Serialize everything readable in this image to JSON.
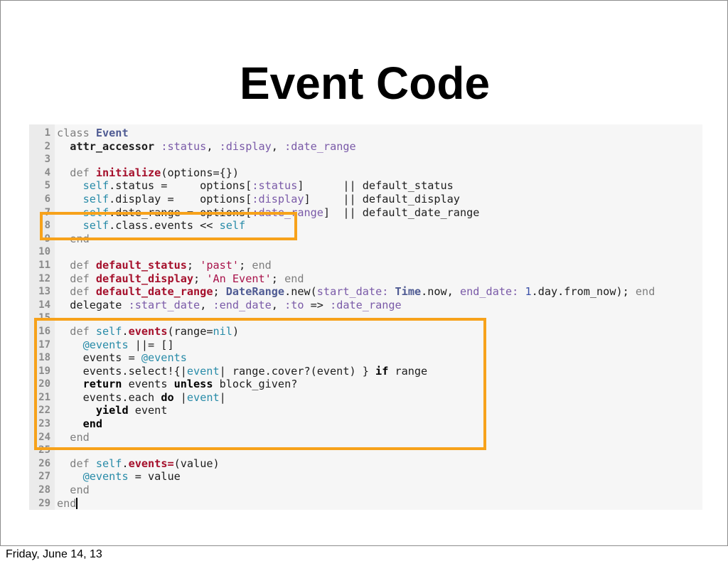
{
  "slide": {
    "title": "Event Code",
    "footer_date": "Friday, June 14, 13"
  },
  "colors": {
    "highlight_border": "#f7a21b",
    "code_background": "#f6f6f6",
    "gutter_background": "#ebebeb"
  },
  "code": {
    "language": "ruby",
    "lines": [
      {
        "n": "1",
        "tokens": [
          [
            "kw",
            "class "
          ],
          [
            "cls",
            "Event"
          ]
        ]
      },
      {
        "n": "2",
        "tokens": [
          [
            "plain",
            "  "
          ],
          [
            "bold",
            "attr_accessor"
          ],
          [
            "sym",
            " :status"
          ],
          [
            "plain",
            ", "
          ],
          [
            "sym",
            ":display"
          ],
          [
            "plain",
            ", "
          ],
          [
            "sym",
            ":date_range"
          ]
        ]
      },
      {
        "n": "3",
        "tokens": []
      },
      {
        "n": "4",
        "tokens": [
          [
            "plain",
            "  "
          ],
          [
            "kw",
            "def "
          ],
          [
            "def",
            "initialize"
          ],
          [
            "plain",
            "(options={})"
          ]
        ]
      },
      {
        "n": "5",
        "tokens": [
          [
            "plain",
            "    "
          ],
          [
            "self",
            "self"
          ],
          [
            "plain",
            ".status =     options["
          ],
          [
            "sym",
            ":status"
          ],
          [
            "plain",
            "]      || default_status"
          ]
        ]
      },
      {
        "n": "6",
        "tokens": [
          [
            "plain",
            "    "
          ],
          [
            "self",
            "self"
          ],
          [
            "plain",
            ".display =    options["
          ],
          [
            "sym",
            ":display"
          ],
          [
            "plain",
            "]     || default_display"
          ]
        ]
      },
      {
        "n": "7",
        "tokens": [
          [
            "plain",
            "    "
          ],
          [
            "self",
            "self"
          ],
          [
            "plain",
            ".date_range = options["
          ],
          [
            "sym",
            ":date_range"
          ],
          [
            "plain",
            "]  || default_date_range"
          ]
        ]
      },
      {
        "n": "8",
        "tokens": [
          [
            "plain",
            "    "
          ],
          [
            "self",
            "self"
          ],
          [
            "plain",
            ".class.events << "
          ],
          [
            "self",
            "self"
          ]
        ]
      },
      {
        "n": "9",
        "tokens": [
          [
            "plain",
            "  "
          ],
          [
            "kw",
            "end"
          ]
        ]
      },
      {
        "n": "10",
        "tokens": []
      },
      {
        "n": "11",
        "tokens": [
          [
            "plain",
            "  "
          ],
          [
            "kw",
            "def "
          ],
          [
            "def",
            "default_status"
          ],
          [
            "plain",
            "; "
          ],
          [
            "str",
            "'past'"
          ],
          [
            "plain",
            "; "
          ],
          [
            "kw",
            "end"
          ]
        ]
      },
      {
        "n": "12",
        "tokens": [
          [
            "plain",
            "  "
          ],
          [
            "kw",
            "def "
          ],
          [
            "def",
            "default_display"
          ],
          [
            "plain",
            "; "
          ],
          [
            "str",
            "'An Event'"
          ],
          [
            "plain",
            "; "
          ],
          [
            "kw",
            "end"
          ]
        ]
      },
      {
        "n": "13",
        "tokens": [
          [
            "plain",
            "  "
          ],
          [
            "kw",
            "def "
          ],
          [
            "def",
            "default_date_range"
          ],
          [
            "plain",
            "; "
          ],
          [
            "const",
            "DateRange"
          ],
          [
            "plain",
            ".new("
          ],
          [
            "sym",
            "start_date:"
          ],
          [
            "plain",
            " "
          ],
          [
            "const",
            "Time"
          ],
          [
            "plain",
            ".now, "
          ],
          [
            "sym",
            "end_date:"
          ],
          [
            "plain",
            " "
          ],
          [
            "num",
            "1"
          ],
          [
            "plain",
            ".day.from_now); "
          ],
          [
            "kw",
            "end"
          ]
        ]
      },
      {
        "n": "14",
        "tokens": [
          [
            "plain",
            "  delegate "
          ],
          [
            "sym",
            ":start_date"
          ],
          [
            "plain",
            ", "
          ],
          [
            "sym",
            ":end_date"
          ],
          [
            "plain",
            ", "
          ],
          [
            "sym",
            ":to"
          ],
          [
            "plain",
            " => "
          ],
          [
            "sym",
            ":date_range"
          ]
        ]
      },
      {
        "n": "15",
        "tokens": []
      },
      {
        "n": "16",
        "tokens": [
          [
            "plain",
            "  "
          ],
          [
            "kw",
            "def "
          ],
          [
            "self",
            "self"
          ],
          [
            "plain",
            "."
          ],
          [
            "def",
            "events"
          ],
          [
            "plain",
            "(range="
          ],
          [
            "self",
            "nil"
          ],
          [
            "plain",
            ")"
          ]
        ]
      },
      {
        "n": "17",
        "tokens": [
          [
            "plain",
            "    "
          ],
          [
            "ivar",
            "@events"
          ],
          [
            "plain",
            " ||= []"
          ]
        ]
      },
      {
        "n": "18",
        "tokens": [
          [
            "plain",
            "    events = "
          ],
          [
            "ivar",
            "@events"
          ]
        ]
      },
      {
        "n": "19",
        "tokens": [
          [
            "plain",
            "    events.select!{|"
          ],
          [
            "ivar",
            "event"
          ],
          [
            "plain",
            "| range.cover?(event) } "
          ],
          [
            "kwb",
            "if"
          ],
          [
            "plain",
            " range"
          ]
        ]
      },
      {
        "n": "20",
        "tokens": [
          [
            "plain",
            "    "
          ],
          [
            "kwb",
            "return"
          ],
          [
            "plain",
            " events "
          ],
          [
            "kwb",
            "unless"
          ],
          [
            "plain",
            " block_given?"
          ]
        ]
      },
      {
        "n": "21",
        "tokens": [
          [
            "plain",
            "    events.each "
          ],
          [
            "kwb",
            "do"
          ],
          [
            "plain",
            " |"
          ],
          [
            "ivar",
            "event"
          ],
          [
            "plain",
            "|"
          ]
        ]
      },
      {
        "n": "22",
        "tokens": [
          [
            "plain",
            "      "
          ],
          [
            "kwb",
            "yield"
          ],
          [
            "plain",
            " event"
          ]
        ]
      },
      {
        "n": "23",
        "tokens": [
          [
            "plain",
            "    "
          ],
          [
            "kwb",
            "end"
          ]
        ]
      },
      {
        "n": "24",
        "tokens": [
          [
            "plain",
            "  "
          ],
          [
            "kw",
            "end"
          ]
        ]
      },
      {
        "n": "25",
        "tokens": []
      },
      {
        "n": "26",
        "tokens": [
          [
            "plain",
            "  "
          ],
          [
            "kw",
            "def "
          ],
          [
            "self",
            "self"
          ],
          [
            "plain",
            "."
          ],
          [
            "def",
            "events="
          ],
          [
            "plain",
            "(value)"
          ]
        ]
      },
      {
        "n": "27",
        "tokens": [
          [
            "plain",
            "    "
          ],
          [
            "ivar",
            "@events"
          ],
          [
            "plain",
            " = value"
          ]
        ]
      },
      {
        "n": "28",
        "tokens": [
          [
            "plain",
            "  "
          ],
          [
            "kw",
            "end"
          ]
        ]
      },
      {
        "n": "29",
        "tokens": [
          [
            "kw",
            "end"
          ]
        ]
      }
    ],
    "cursor_line": "29"
  }
}
